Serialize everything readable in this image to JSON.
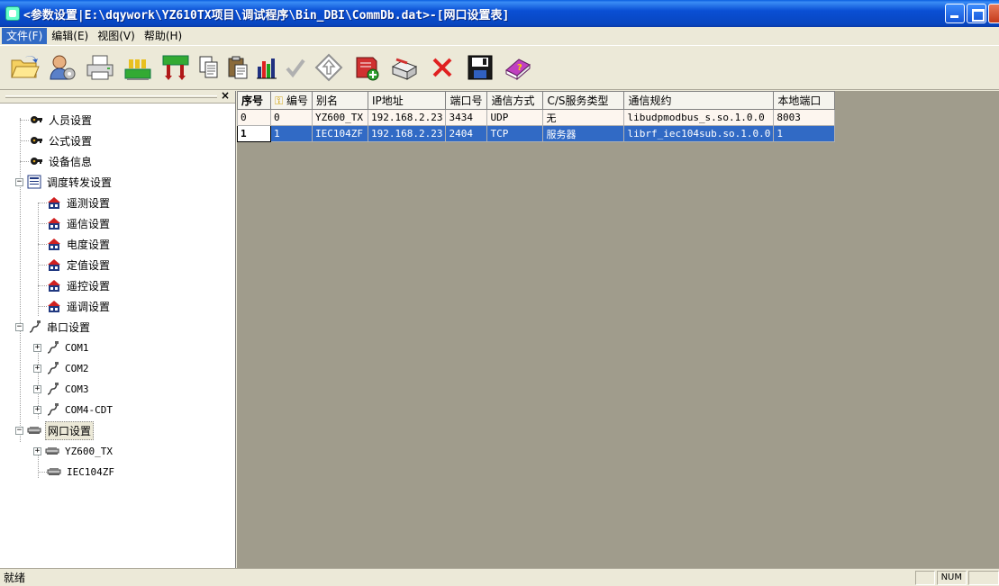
{
  "window": {
    "title": "<参数设置|E:\\dqywork\\YZ610TX项目\\调试程序\\Bin_DBI\\CommDb.dat>-[网口设置表]"
  },
  "menu": [
    "文件(F)",
    "编辑(E)",
    "视图(V)",
    "帮助(H)"
  ],
  "toolbar": {
    "icons": [
      "open-folder-icon",
      "settings-person-icon",
      "print-icon",
      "chip-download-icon",
      "chip-upload-icon",
      "copy-icon",
      "paste-icon",
      "bar-chart-icon",
      "check-icon",
      "up-arrow-icon",
      "add-record-icon",
      "edit-record-icon",
      "delete-icon",
      "save-icon",
      "help-book-icon"
    ]
  },
  "tree": {
    "personnel": "人员设置",
    "formula": "公式设置",
    "device_info": "设备信息",
    "dispatch": "调度转发设置",
    "dispatch_children": [
      "遥测设置",
      "遥信设置",
      "电度设置",
      "定值设置",
      "遥控设置",
      "遥调设置"
    ],
    "serial": "串口设置",
    "serial_children": [
      "COM1",
      "COM2",
      "COM3",
      "COM4-CDT"
    ],
    "network": "网口设置",
    "network_children": [
      "YZ600_TX",
      "IEC104ZF"
    ]
  },
  "grid": {
    "headers": [
      "序号",
      "编号",
      "别名",
      "IP地址",
      "端口号",
      "通信方式",
      "C/S服务类型",
      "通信规约",
      "本地端口"
    ],
    "rows": [
      [
        "0",
        "0",
        "YZ600_TX",
        "192.168.2.23",
        "3434",
        "UDP",
        "无",
        "libudpmodbus_s.so.1.0.0",
        "8003"
      ],
      [
        "1",
        "1",
        "IEC104ZF",
        "192.168.2.23",
        "2404",
        "TCP",
        "服务器",
        "librf_iec104sub.so.1.0.0",
        "1"
      ]
    ]
  },
  "status": {
    "text": "就绪",
    "num": "NUM"
  },
  "colors": {
    "titlebar": "#0a4fd4",
    "selection": "#316ac5",
    "mdi_background": "#a09c8c"
  }
}
